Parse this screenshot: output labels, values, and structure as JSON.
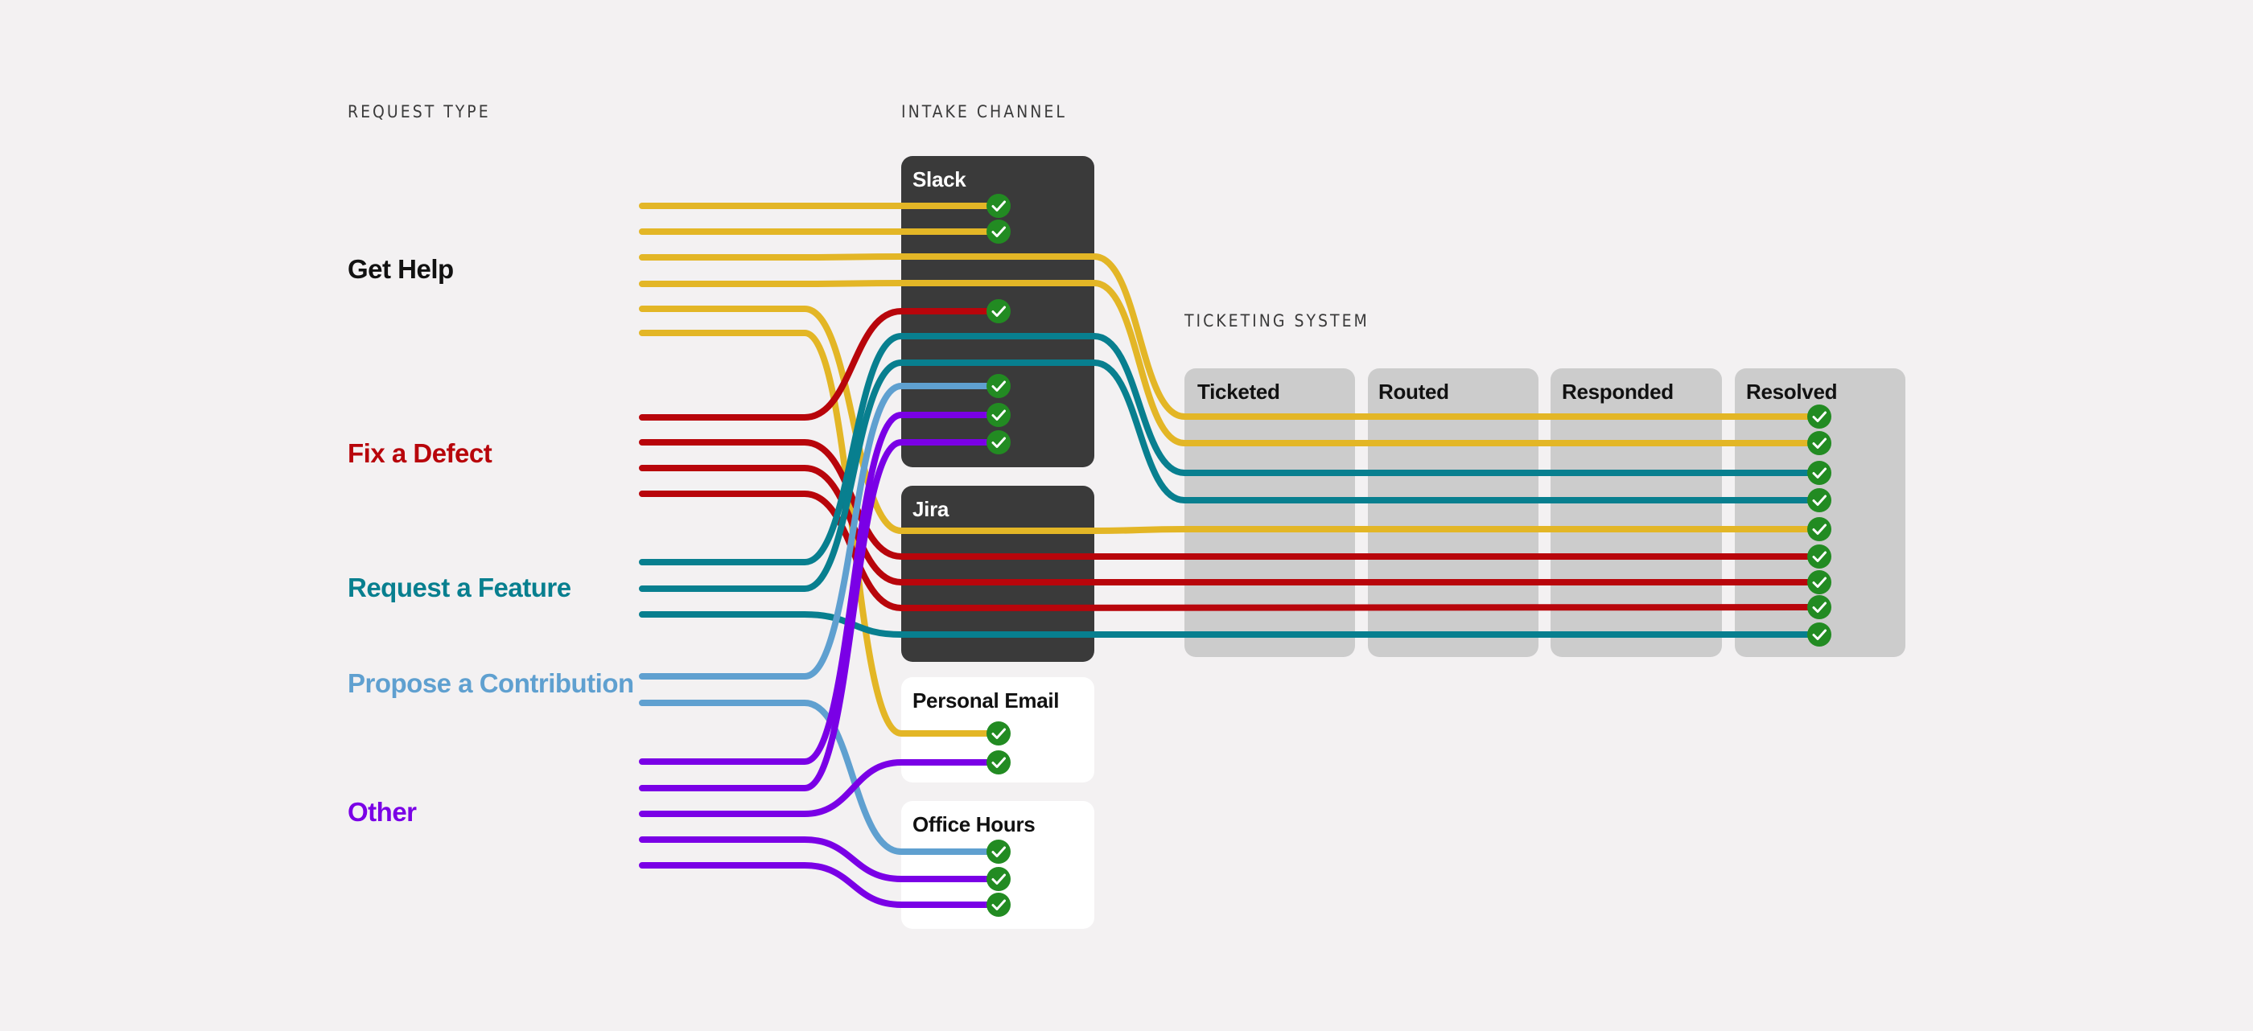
{
  "colors": {
    "background": "#F3F1F2",
    "get_help": "#E3B626",
    "fix_defect": "#B8050B",
    "request_feature": "#087F8F",
    "propose_contribution": "#5FA0D0",
    "other": "#7A00E6",
    "check": "#228B22",
    "channel_dark": "#3A3A3A",
    "channel_light": "#FFFFFF",
    "ticket_column": "#CCCCCC"
  },
  "sections": {
    "request_type": "REQUEST TYPE",
    "intake_channel": "INTAKE CHANNEL",
    "ticketing_system": "TICKETING SYSTEM"
  },
  "request_types": [
    {
      "id": "get_help",
      "label": "Get Help",
      "color": "#111111",
      "line_color": "#E3B626"
    },
    {
      "id": "fix_defect",
      "label": "Fix a Defect",
      "color": "#B8050B",
      "line_color": "#B8050B"
    },
    {
      "id": "request_feature",
      "label": "Request a Feature",
      "color": "#087F8F",
      "line_color": "#087F8F"
    },
    {
      "id": "propose_contribution",
      "label": "Propose a Contribution",
      "color": "#5FA0D0",
      "line_color": "#5FA0D0"
    },
    {
      "id": "other",
      "label": "Other",
      "color": "#7A00E6",
      "line_color": "#7A00E6"
    }
  ],
  "channels": [
    {
      "id": "slack",
      "label": "Slack",
      "style": "dark"
    },
    {
      "id": "jira",
      "label": "Jira",
      "style": "dark"
    },
    {
      "id": "email",
      "label": "Personal Email",
      "style": "light"
    },
    {
      "id": "office_hours",
      "label": "Office Hours",
      "style": "light"
    }
  ],
  "ticket_stages": [
    "Ticketed",
    "Routed",
    "Responded",
    "Resolved"
  ],
  "requests": [
    {
      "type": "get_help",
      "channel": "slack",
      "outcome": "resolved_in_channel"
    },
    {
      "type": "get_help",
      "channel": "slack",
      "outcome": "resolved_in_channel"
    },
    {
      "type": "get_help",
      "channel": "slack",
      "outcome": "ticketed_resolved"
    },
    {
      "type": "get_help",
      "channel": "slack",
      "outcome": "ticketed_resolved"
    },
    {
      "type": "get_help",
      "channel": "jira",
      "outcome": "ticketed_resolved"
    },
    {
      "type": "get_help",
      "channel": "email",
      "outcome": "resolved_in_channel"
    },
    {
      "type": "fix_defect",
      "channel": "slack",
      "outcome": "resolved_in_channel"
    },
    {
      "type": "fix_defect",
      "channel": "jira",
      "outcome": "ticketed_resolved"
    },
    {
      "type": "fix_defect",
      "channel": "jira",
      "outcome": "ticketed_resolved"
    },
    {
      "type": "fix_defect",
      "channel": "jira",
      "outcome": "ticketed_resolved"
    },
    {
      "type": "request_feature",
      "channel": "slack",
      "outcome": "ticketed_resolved"
    },
    {
      "type": "request_feature",
      "channel": "slack",
      "outcome": "ticketed_resolved"
    },
    {
      "type": "request_feature",
      "channel": "jira",
      "outcome": "ticketed_resolved"
    },
    {
      "type": "propose_contribution",
      "channel": "slack",
      "outcome": "resolved_in_channel"
    },
    {
      "type": "propose_contribution",
      "channel": "office_hours",
      "outcome": "resolved_in_channel"
    },
    {
      "type": "other",
      "channel": "slack",
      "outcome": "resolved_in_channel"
    },
    {
      "type": "other",
      "channel": "slack",
      "outcome": "resolved_in_channel"
    },
    {
      "type": "other",
      "channel": "email",
      "outcome": "resolved_in_channel"
    },
    {
      "type": "other",
      "channel": "office_hours",
      "outcome": "resolved_in_channel"
    },
    {
      "type": "other",
      "channel": "office_hours",
      "outcome": "resolved_in_channel"
    }
  ],
  "check_icon": "check-circle-icon"
}
